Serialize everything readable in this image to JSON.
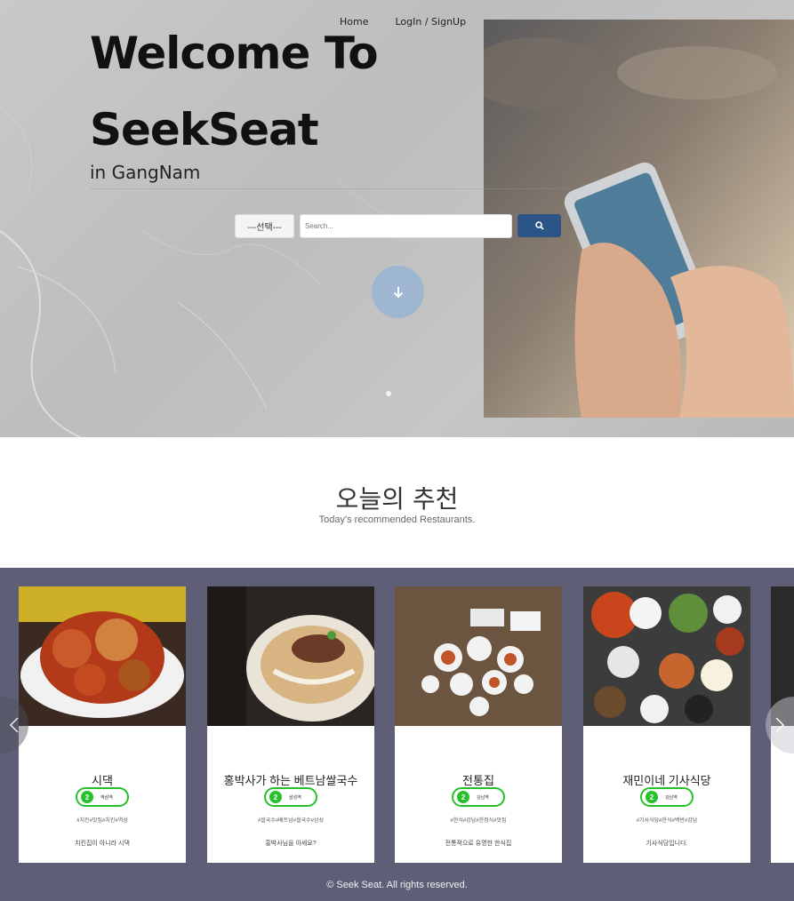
{
  "nav": {
    "home": "Home",
    "login": "LogIn / SignUp"
  },
  "hero": {
    "line1": "Welcome To",
    "line2": "SeekSeat",
    "line3": "in GangNam"
  },
  "search": {
    "select_value": "---선택---",
    "placeholder": "Search...",
    "button_icon": "search-icon"
  },
  "scroll_icon": "arrow-down-icon",
  "section": {
    "title": "오늘의 추천",
    "subtitle": "Today's recommended Restaurants."
  },
  "cards": [
    {
      "name": "시댁",
      "line_no": "2",
      "station": "역삼역",
      "tags": "#치킨#맛집#치킨#역삼",
      "desc": "치킨집이 아니라 시댁"
    },
    {
      "name": "홍박사가 하는 베트남쌀국수",
      "line_no": "2",
      "station": "삼성역",
      "tags": "#쌀국수#베트남#쌀국수#삼성",
      "desc": "홍박사님을 아세요?"
    },
    {
      "name": "전통집",
      "line_no": "2",
      "station": "강남역",
      "tags": "#한식#강남#한정식#맛집",
      "desc": "전통적으로 유명한 한식집"
    },
    {
      "name": "재민이네 기사식당",
      "line_no": "2",
      "station": "강남역",
      "tags": "#기사식당#한식#백반#강남",
      "desc": "기사식당입니다."
    }
  ],
  "footer": "© Seek Seat. All rights reserved.",
  "colors": {
    "accent": "#2a5586",
    "carousel_bg": "#5e5f77",
    "line2_green": "#27c22b"
  }
}
